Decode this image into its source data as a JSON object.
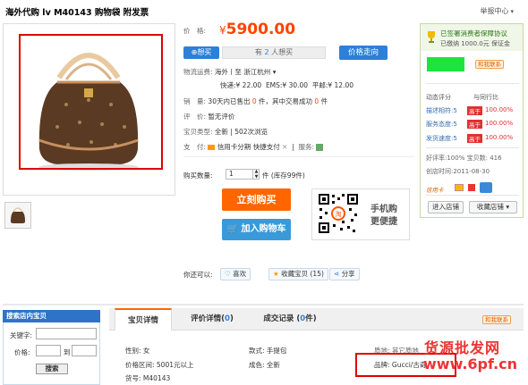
{
  "header": {
    "title": "海外代购 lv M40143 购物袋 附发票",
    "report_label": "举报中心"
  },
  "price": {
    "label": "价　格:",
    "currency": "¥",
    "value": "5900.00"
  },
  "want": {
    "button_label": "想买",
    "count_prefix": "有",
    "count": "2",
    "count_suffix": "人想买",
    "trend_label": "价格走向"
  },
  "shipping": {
    "label": "物流运费:",
    "route": "海外丨至 浙江杭州",
    "express": "快递:¥ 22.00",
    "ems": "EMS:¥ 30.00",
    "mail": "平邮:¥ 12.00"
  },
  "sales": {
    "label": "销　量:",
    "prefix": "30天内已售出",
    "sold": "0",
    "mid": "件，其中交易成功",
    "success": "0",
    "suffix": "件"
  },
  "rating": {
    "label": "评　价:",
    "value": "暂无评价"
  },
  "type": {
    "label": "宝贝类型:",
    "value": "全新",
    "views": "502次浏览"
  },
  "payment": {
    "label": "支　付:",
    "methods": [
      "信用卡分期",
      "快捷支付"
    ],
    "service_label": "服务:"
  },
  "quantity": {
    "label": "购买数量:",
    "value": "1",
    "stock": "件 (库存99件)"
  },
  "actions": {
    "buy": "立刻购买",
    "cart": "加入购物车"
  },
  "mobile": {
    "line1": "手机购",
    "line2": "更便捷"
  },
  "share": {
    "label": "你还可以:",
    "items": [
      "喜欢",
      "收藏宝贝 (15)",
      "分享"
    ]
  },
  "sidebar": {
    "protocol": "已签署消费者保障协议",
    "deposit": "已缴纳 1000.0元 保证金",
    "contact": "和我联系",
    "dynamic_label": "动态评分",
    "compare_label": "与同行比",
    "scores": [
      {
        "label": "描述相符:5",
        "badge": "高于",
        "rate": "100.00%"
      },
      {
        "label": "服务态度:5",
        "badge": "高于",
        "rate": "100.00%"
      },
      {
        "label": "发货速度:5",
        "badge": "高于",
        "rate": "100.00%"
      }
    ],
    "positive": "好评率:100%",
    "credit": "宝贝数: 416",
    "created": "创店时间:2011-08-30",
    "credit_card": "信用卡",
    "enter_shop": "进入店铺",
    "fav_shop": "收藏店铺"
  },
  "search_panel": {
    "title": "搜索店内宝贝",
    "keyword_label": "关键字:",
    "price_label": "价格:",
    "to": "到",
    "button": "搜索"
  },
  "tabs": [
    {
      "label": "宝贝详情",
      "count": ""
    },
    {
      "label": "评价详情(",
      "count": "0",
      "suffix": ")"
    },
    {
      "label": "成交记录 (",
      "count": "0",
      "suffix": "件)"
    }
  ],
  "contact2": "和我联系",
  "attributes": {
    "gender": "性别: 女",
    "style": "款式: 手提包",
    "price_range": "价格区间: 5001元以上",
    "condition": "成色: 全新",
    "item_no": "货号: M40143",
    "brand": "品牌: Gucci/古奇",
    "material": "质地: 其它质地"
  },
  "watermark": {
    "line1": "货源批发网",
    "line2": "www.6pf.cn"
  }
}
